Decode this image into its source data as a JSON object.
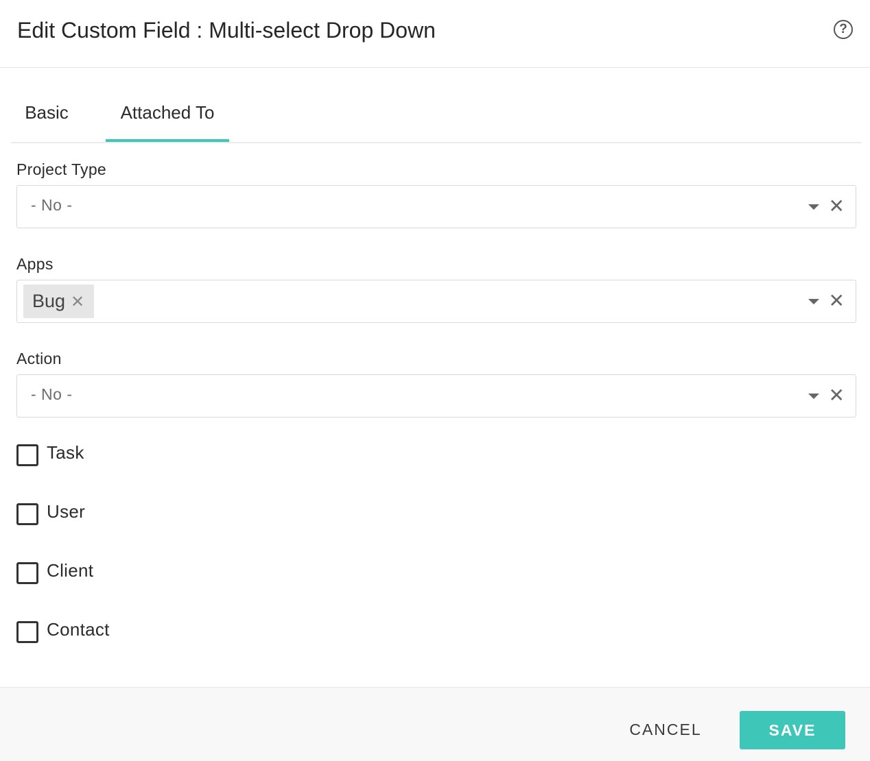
{
  "dialog": {
    "title": "Edit Custom Field : Multi-select Drop Down",
    "help_icon": "question-circle-icon",
    "help_glyph": "?"
  },
  "tabs": [
    {
      "label": "Basic",
      "active": false
    },
    {
      "label": "Attached To",
      "active": true
    }
  ],
  "fields": {
    "project_type": {
      "label": "Project Type",
      "value": "- No -"
    },
    "apps": {
      "label": "Apps",
      "tags": [
        {
          "label": "Bug",
          "remove_glyph": "✕"
        }
      ]
    },
    "action": {
      "label": "Action",
      "value": "- No -"
    }
  },
  "select_controls": {
    "caret_icon": "caret-down-icon",
    "clear_icon": "clear-x-icon",
    "clear_glyph": "✕"
  },
  "checkboxes": [
    {
      "label": "Task",
      "checked": false
    },
    {
      "label": "User",
      "checked": false
    },
    {
      "label": "Client",
      "checked": false
    },
    {
      "label": "Contact",
      "checked": false
    }
  ],
  "footer": {
    "cancel_label": "CANCEL",
    "save_label": "SAVE"
  },
  "colors": {
    "accent": "#3ec6b8",
    "footer_bg": "#f8f8f8",
    "border": "#d8d8d8"
  }
}
